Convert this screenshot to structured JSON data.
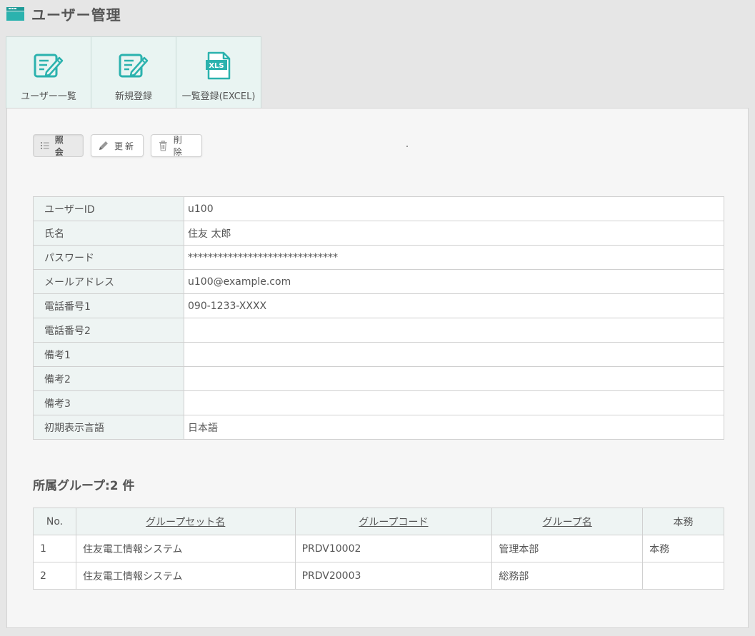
{
  "header": {
    "title": "ユーザー管理",
    "icon": "window-icon"
  },
  "colors": {
    "accent": "#2bb2ae",
    "tab_bg": "#e9f4f2",
    "label_bg": "#eef4f3"
  },
  "tabs": [
    {
      "label": "ユーザー一覧",
      "icon": "edit-list-icon"
    },
    {
      "label": "新規登録",
      "icon": "edit-new-icon"
    },
    {
      "label": "一覧登録(EXCEL)",
      "icon": "xls-file-icon",
      "icon_text": "XLS"
    }
  ],
  "toolbar": {
    "view_label": "照会",
    "update_label": "更新",
    "delete_label": "削除"
  },
  "details": [
    {
      "label": "ユーザーID",
      "value": "u100"
    },
    {
      "label": "氏名",
      "value": "住友 太郎"
    },
    {
      "label": "パスワード",
      "value": "******************************"
    },
    {
      "label": "メールアドレス",
      "value": "u100@example.com"
    },
    {
      "label": "電話番号1",
      "value": "090-1233-XXXX"
    },
    {
      "label": "電話番号2",
      "value": ""
    },
    {
      "label": "備考1",
      "value": ""
    },
    {
      "label": "備考2",
      "value": ""
    },
    {
      "label": "備考3",
      "value": ""
    },
    {
      "label": "初期表示言語",
      "value": "日本語"
    }
  ],
  "groups": {
    "title": "所属グループ:2 件",
    "columns": [
      "No.",
      "グループセット名",
      "グループコード",
      "グループ名",
      "本務"
    ],
    "rows": [
      [
        "1",
        "住友電工情報システム",
        "PRDV10002",
        "管理本部",
        "本務"
      ],
      [
        "2",
        "住友電工情報システム",
        "PRDV20003",
        "総務部",
        ""
      ]
    ]
  }
}
